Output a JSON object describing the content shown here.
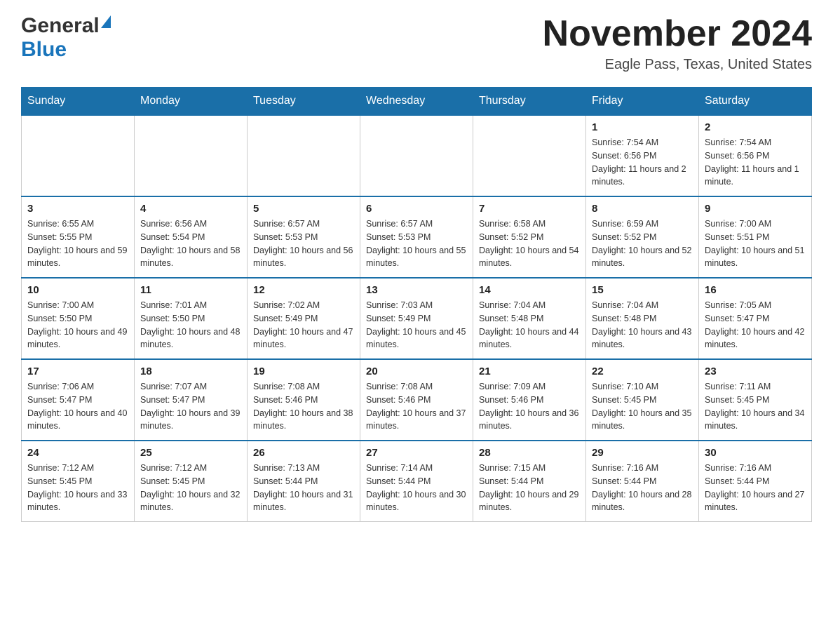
{
  "header": {
    "logo_general": "General",
    "logo_blue": "Blue",
    "month_title": "November 2024",
    "location": "Eagle Pass, Texas, United States"
  },
  "weekdays": [
    "Sunday",
    "Monday",
    "Tuesday",
    "Wednesday",
    "Thursday",
    "Friday",
    "Saturday"
  ],
  "weeks": [
    [
      {
        "day": "",
        "info": ""
      },
      {
        "day": "",
        "info": ""
      },
      {
        "day": "",
        "info": ""
      },
      {
        "day": "",
        "info": ""
      },
      {
        "day": "",
        "info": ""
      },
      {
        "day": "1",
        "info": "Sunrise: 7:54 AM\nSunset: 6:56 PM\nDaylight: 11 hours and 2 minutes."
      },
      {
        "day": "2",
        "info": "Sunrise: 7:54 AM\nSunset: 6:56 PM\nDaylight: 11 hours and 1 minute."
      }
    ],
    [
      {
        "day": "3",
        "info": "Sunrise: 6:55 AM\nSunset: 5:55 PM\nDaylight: 10 hours and 59 minutes."
      },
      {
        "day": "4",
        "info": "Sunrise: 6:56 AM\nSunset: 5:54 PM\nDaylight: 10 hours and 58 minutes."
      },
      {
        "day": "5",
        "info": "Sunrise: 6:57 AM\nSunset: 5:53 PM\nDaylight: 10 hours and 56 minutes."
      },
      {
        "day": "6",
        "info": "Sunrise: 6:57 AM\nSunset: 5:53 PM\nDaylight: 10 hours and 55 minutes."
      },
      {
        "day": "7",
        "info": "Sunrise: 6:58 AM\nSunset: 5:52 PM\nDaylight: 10 hours and 54 minutes."
      },
      {
        "day": "8",
        "info": "Sunrise: 6:59 AM\nSunset: 5:52 PM\nDaylight: 10 hours and 52 minutes."
      },
      {
        "day": "9",
        "info": "Sunrise: 7:00 AM\nSunset: 5:51 PM\nDaylight: 10 hours and 51 minutes."
      }
    ],
    [
      {
        "day": "10",
        "info": "Sunrise: 7:00 AM\nSunset: 5:50 PM\nDaylight: 10 hours and 49 minutes."
      },
      {
        "day": "11",
        "info": "Sunrise: 7:01 AM\nSunset: 5:50 PM\nDaylight: 10 hours and 48 minutes."
      },
      {
        "day": "12",
        "info": "Sunrise: 7:02 AM\nSunset: 5:49 PM\nDaylight: 10 hours and 47 minutes."
      },
      {
        "day": "13",
        "info": "Sunrise: 7:03 AM\nSunset: 5:49 PM\nDaylight: 10 hours and 45 minutes."
      },
      {
        "day": "14",
        "info": "Sunrise: 7:04 AM\nSunset: 5:48 PM\nDaylight: 10 hours and 44 minutes."
      },
      {
        "day": "15",
        "info": "Sunrise: 7:04 AM\nSunset: 5:48 PM\nDaylight: 10 hours and 43 minutes."
      },
      {
        "day": "16",
        "info": "Sunrise: 7:05 AM\nSunset: 5:47 PM\nDaylight: 10 hours and 42 minutes."
      }
    ],
    [
      {
        "day": "17",
        "info": "Sunrise: 7:06 AM\nSunset: 5:47 PM\nDaylight: 10 hours and 40 minutes."
      },
      {
        "day": "18",
        "info": "Sunrise: 7:07 AM\nSunset: 5:47 PM\nDaylight: 10 hours and 39 minutes."
      },
      {
        "day": "19",
        "info": "Sunrise: 7:08 AM\nSunset: 5:46 PM\nDaylight: 10 hours and 38 minutes."
      },
      {
        "day": "20",
        "info": "Sunrise: 7:08 AM\nSunset: 5:46 PM\nDaylight: 10 hours and 37 minutes."
      },
      {
        "day": "21",
        "info": "Sunrise: 7:09 AM\nSunset: 5:46 PM\nDaylight: 10 hours and 36 minutes."
      },
      {
        "day": "22",
        "info": "Sunrise: 7:10 AM\nSunset: 5:45 PM\nDaylight: 10 hours and 35 minutes."
      },
      {
        "day": "23",
        "info": "Sunrise: 7:11 AM\nSunset: 5:45 PM\nDaylight: 10 hours and 34 minutes."
      }
    ],
    [
      {
        "day": "24",
        "info": "Sunrise: 7:12 AM\nSunset: 5:45 PM\nDaylight: 10 hours and 33 minutes."
      },
      {
        "day": "25",
        "info": "Sunrise: 7:12 AM\nSunset: 5:45 PM\nDaylight: 10 hours and 32 minutes."
      },
      {
        "day": "26",
        "info": "Sunrise: 7:13 AM\nSunset: 5:44 PM\nDaylight: 10 hours and 31 minutes."
      },
      {
        "day": "27",
        "info": "Sunrise: 7:14 AM\nSunset: 5:44 PM\nDaylight: 10 hours and 30 minutes."
      },
      {
        "day": "28",
        "info": "Sunrise: 7:15 AM\nSunset: 5:44 PM\nDaylight: 10 hours and 29 minutes."
      },
      {
        "day": "29",
        "info": "Sunrise: 7:16 AM\nSunset: 5:44 PM\nDaylight: 10 hours and 28 minutes."
      },
      {
        "day": "30",
        "info": "Sunrise: 7:16 AM\nSunset: 5:44 PM\nDaylight: 10 hours and 27 minutes."
      }
    ]
  ]
}
